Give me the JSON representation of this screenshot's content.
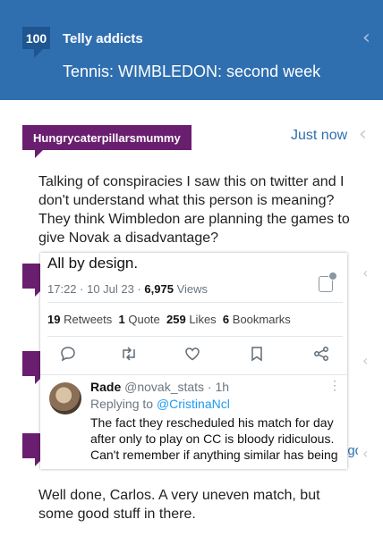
{
  "header": {
    "count": "100",
    "forum_name": "Telly addicts",
    "thread_title": "Tennis: WIMBLEDON: second week",
    "back_icon": "chevron-left-icon",
    "bg_color": "#2f6fb0"
  },
  "post1": {
    "username": "Hungrycaterpillarsmummy",
    "time": "Just now",
    "body": "Talking of conspiracies I saw this on twitter and I don't understand what this person is meaning? They think Wimbledon are planning the games to give Novak a disadvantage?"
  },
  "tweet": {
    "text": "All by design.",
    "timestamp": "17:22 · 10 Jul 23 · ",
    "views_count": "6,975",
    "views_label": " Views",
    "retweets_count": "19",
    "retweets_label": " Retweets",
    "quote_count": "1",
    "quote_label": " Quote",
    "likes_count": "259",
    "likes_label": " Likes",
    "bookmarks_count": "6",
    "bookmarks_label": " Bookmarks",
    "actions": [
      "reply-icon",
      "retweet-icon",
      "like-icon",
      "bookmark-icon",
      "share-icon"
    ],
    "reply": {
      "name": "Rade",
      "handle": " @novak_stats · 1h",
      "replying_prefix": "Replying to ",
      "replying_to": "@CristinaNcl",
      "body": "The fact they rescheduled his match for day after only to play on CC is bloody ridiculous. Can't remember if anything similar has being"
    }
  },
  "post_last": {
    "time_partial": "ago",
    "body": "Well done, Carlos. A very uneven match, but some good stuff in there."
  },
  "colors": {
    "user_tag": "#6a1e6f",
    "link": "#2f6fb0",
    "twitter_link": "#1d9bf0"
  }
}
